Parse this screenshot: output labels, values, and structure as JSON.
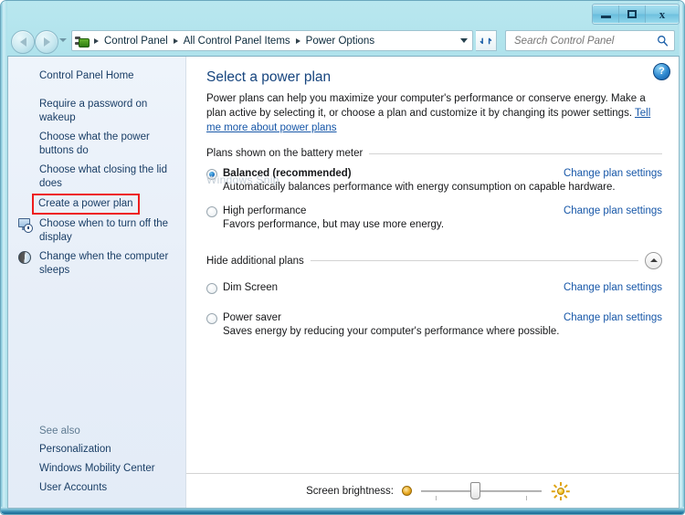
{
  "window": {
    "buttons": {
      "minimize": "Minimize",
      "maximize": "Maximize",
      "close": "Close"
    }
  },
  "navbar": {
    "back": "Back",
    "forward": "Forward",
    "recent_pages": "Recent pages",
    "breadcrumbs": [
      "Control Panel",
      "All Control Panel Items",
      "Power Options"
    ],
    "address_dropdown": "Previous locations",
    "refresh": "Refresh",
    "search": {
      "value": "",
      "placeholder": "Search Control Panel",
      "icon": "search-icon"
    },
    "icons": {
      "control_panel": "control-panel-icon"
    }
  },
  "sidebar": {
    "home": "Control Panel Home",
    "items": [
      {
        "label": "Require a password on wakeup",
        "icon": null
      },
      {
        "label": "Choose what the power buttons do",
        "icon": null
      },
      {
        "label": "Choose what closing the lid does",
        "icon": null
      },
      {
        "label": "Create a power plan",
        "icon": null,
        "highlighted": true,
        "highlight_color": "#ee1c1c"
      },
      {
        "label": "Choose when to turn off the display",
        "icon": "display-clock-icon"
      },
      {
        "label": "Change when the computer sleeps",
        "icon": "moon-icon"
      }
    ],
    "see_also": {
      "label": "See also",
      "links": [
        "Personalization",
        "Windows Mobility Center",
        "User Accounts"
      ]
    }
  },
  "content": {
    "help_button": "?",
    "title": "Select a power plan",
    "intro": {
      "text": "Power plans can help you maximize your computer's performance or conserve energy. Make a plan active by selecting it, or choose a plan and customize it by changing its power settings. ",
      "link": "Tell me more about power plans"
    },
    "watermark": "Windows Snip",
    "groups": [
      {
        "header": "Plans shown on the battery meter",
        "has_collapse_button": false,
        "plans": [
          {
            "name": "Balanced (recommended)",
            "selected": true,
            "bold": true,
            "description": "Automatically balances performance with energy consumption on capable hardware.",
            "action": "Change plan settings"
          },
          {
            "name": "High performance",
            "selected": false,
            "bold": false,
            "description": "Favors performance, but may use more energy.",
            "action": "Change plan settings"
          }
        ]
      },
      {
        "header": "Hide additional plans",
        "has_collapse_button": true,
        "collapse_icon": "chevron-up-icon",
        "plans": [
          {
            "name": "Dim Screen",
            "selected": false,
            "bold": false,
            "description": "",
            "action": "Change plan settings"
          },
          {
            "name": "Power saver",
            "selected": false,
            "bold": false,
            "description": "Saves energy by reducing your computer's performance where possible.",
            "action": "Change plan settings"
          }
        ]
      }
    ],
    "brightness": {
      "label": "Screen brightness:",
      "low_icon": "dim-sun-icon",
      "high_icon": "bright-sun-icon",
      "value_percent": 45
    }
  },
  "colors": {
    "accent_link": "#1757a8",
    "title": "#17457e",
    "highlight": "#ee1c1c",
    "frame": "#a8dfe9"
  }
}
